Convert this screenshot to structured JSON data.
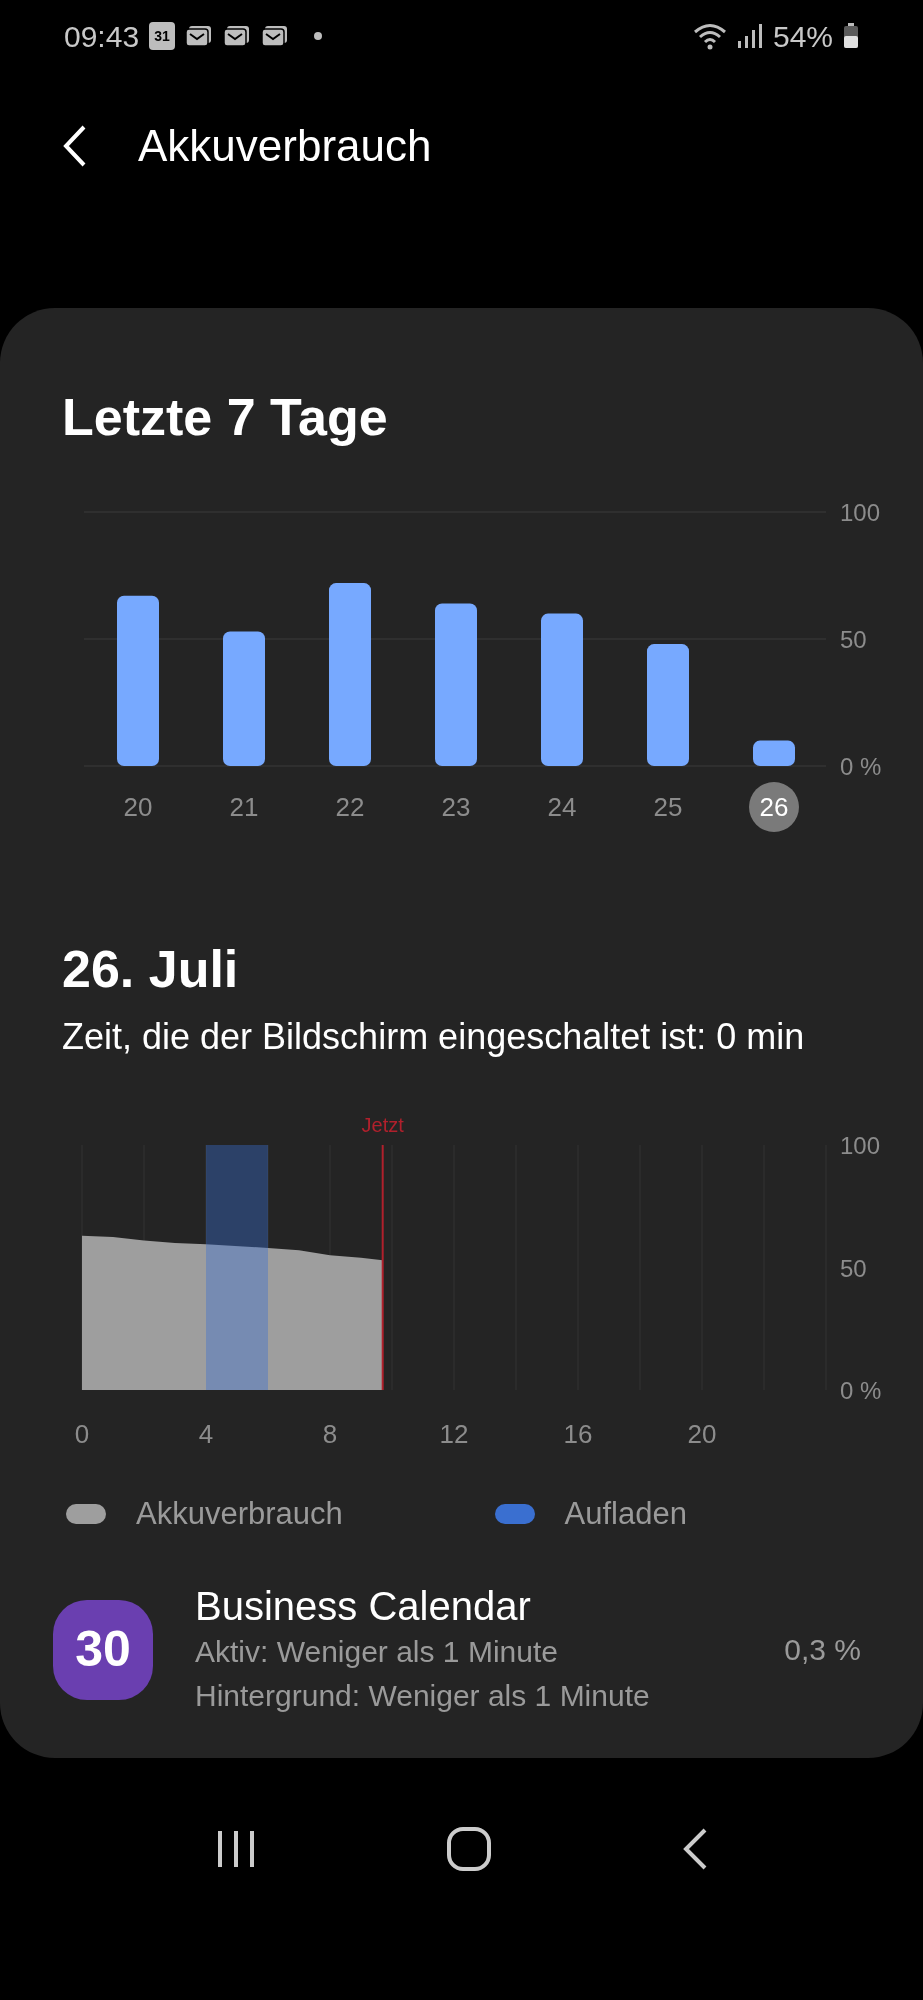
{
  "status_bar": {
    "time": "09:43",
    "calendar_day": "31",
    "battery": "54%"
  },
  "header": {
    "title": "Akkuverbrauch"
  },
  "weekly": {
    "title": "Letzte 7 Tage",
    "chart_data": {
      "type": "bar",
      "categories": [
        "20",
        "21",
        "22",
        "23",
        "24",
        "25",
        "26"
      ],
      "values": [
        67,
        53,
        72,
        64,
        60,
        48,
        10
      ],
      "ylim": [
        0,
        100
      ],
      "grid": true,
      "yticks": [
        {
          "value": 100,
          "label": "100"
        },
        {
          "value": 50,
          "label": "50"
        },
        {
          "value": 0,
          "label": "0 %"
        }
      ]
    },
    "day_states": [
      {
        "selected": false
      },
      {
        "selected": false
      },
      {
        "selected": false
      },
      {
        "selected": false
      },
      {
        "selected": false
      },
      {
        "selected": false
      },
      {
        "selected": true
      }
    ]
  },
  "daily": {
    "title": "26. Juli",
    "screen_time": "Zeit, die der Bildschirm eingeschaltet ist: 0 min",
    "chart_data": {
      "type": "area",
      "x": [
        0,
        1,
        2,
        3,
        4,
        6,
        7,
        8,
        9,
        9.7
      ],
      "series": [
        {
          "name": "Akkuverbrauch",
          "color": "#9e9e9e",
          "values": [
            63,
            62.5,
            61,
            60,
            59.5,
            58,
            57,
            55,
            54,
            53
          ]
        }
      ],
      "xlim": [
        0,
        24
      ],
      "ylim": [
        0,
        100
      ],
      "grid": true,
      "xticks": [
        0,
        4,
        8,
        12,
        16,
        20
      ],
      "yticks": [
        {
          "value": 100,
          "label": "100"
        },
        {
          "value": 50,
          "label": "50"
        },
        {
          "value": 0,
          "label": "0 %"
        }
      ],
      "bands": [
        {
          "axis": "x",
          "from": 4,
          "to": 6,
          "label": "Aufladen",
          "color": "#3a6fd0"
        }
      ],
      "ref_lines": [
        {
          "axis": "x",
          "value": 9.7,
          "label": "Jetzt",
          "color": "#b0202c"
        }
      ]
    }
  },
  "apps": [
    {
      "icon_text": "30",
      "name": "Business Calendar",
      "active": "Aktiv: Weniger als 1 Minute",
      "background": "Hintergrund: Weniger als 1 Minute",
      "share": "0,3 %"
    }
  ]
}
